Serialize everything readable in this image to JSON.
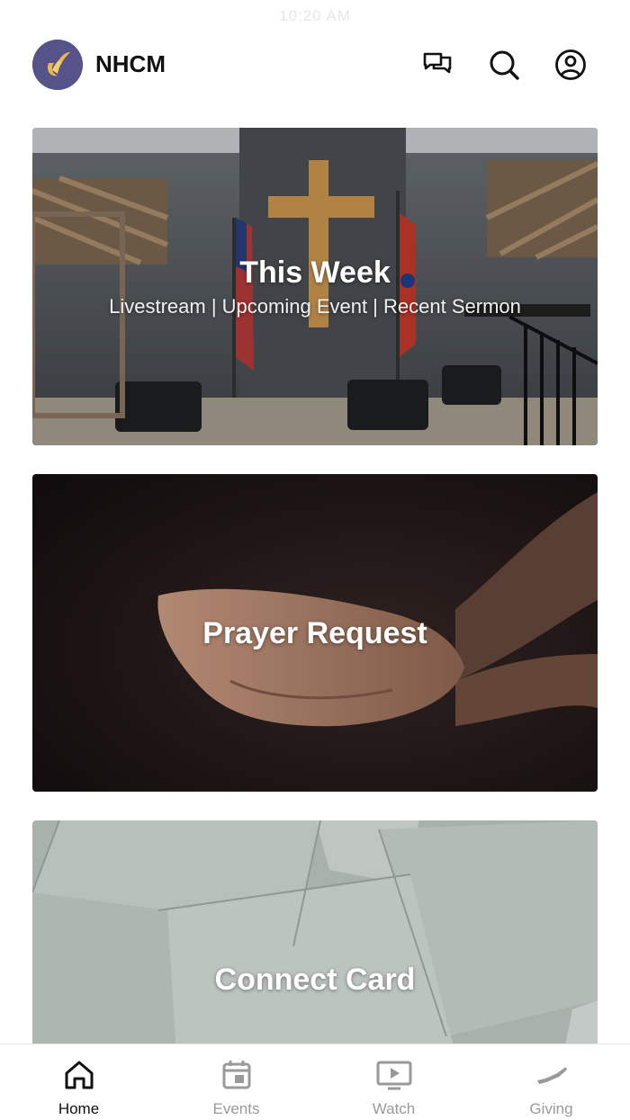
{
  "status": {
    "time": "10:20 AM"
  },
  "header": {
    "brand": "NHCM",
    "icons": [
      "logo-icon",
      "chat-icon",
      "search-icon",
      "profile-icon"
    ]
  },
  "cards": [
    {
      "title": "This Week",
      "subtitle": "Livestream | Upcoming Event | Recent Sermon"
    },
    {
      "title": "Prayer Request"
    },
    {
      "title": "Connect Card"
    }
  ],
  "tabs": [
    {
      "label": "Home",
      "icon": "home-icon",
      "active": true
    },
    {
      "label": "Events",
      "icon": "calendar-icon",
      "active": false
    },
    {
      "label": "Watch",
      "icon": "play-screen-icon",
      "active": false
    },
    {
      "label": "Giving",
      "icon": "giving-hand-icon",
      "active": false
    }
  ],
  "colors": {
    "active_tab": "#111111",
    "inactive_tab": "#9a9a9a",
    "logo_bg": "#55538a",
    "logo_accent": "#e9b84a"
  }
}
